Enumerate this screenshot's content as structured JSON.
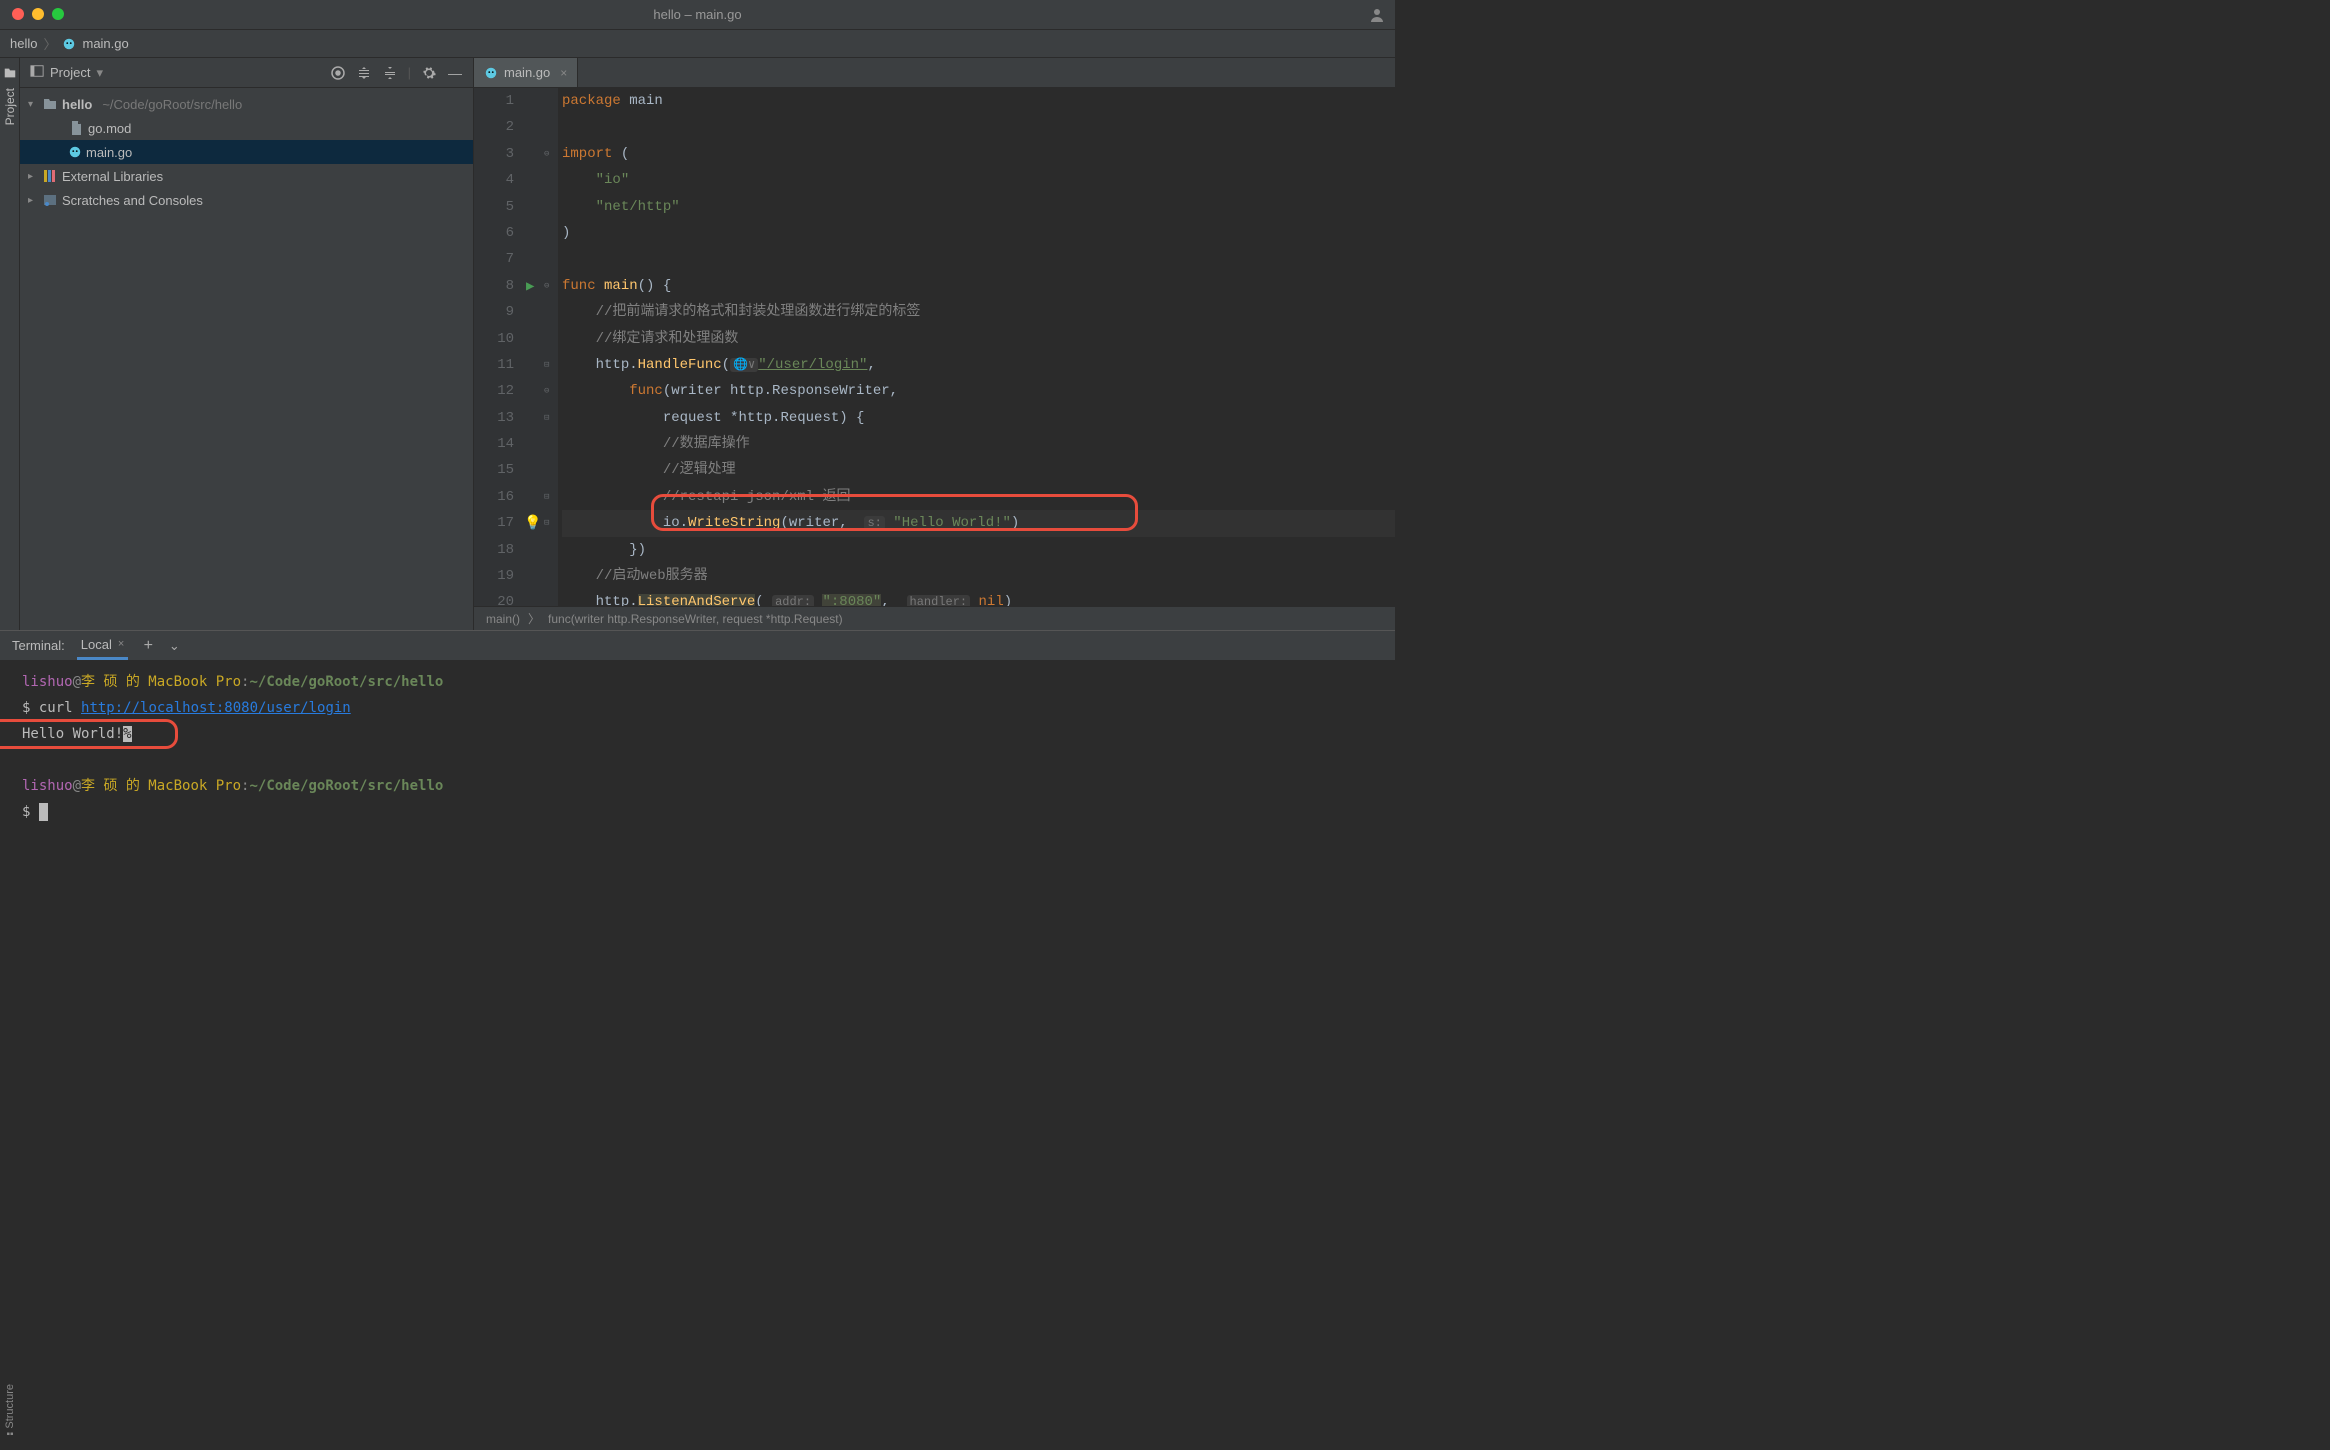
{
  "topbar_center": "hello – main.go",
  "breadcrumb": {
    "root": "hello",
    "file": "main.go"
  },
  "project_panel": {
    "title": "Project",
    "tree": {
      "root": {
        "name": "hello",
        "path": "~/Code/goRoot/src/hello"
      },
      "files": [
        "go.mod",
        "main.go"
      ],
      "ext_libs": "External Libraries",
      "scratches": "Scratches and Consoles"
    }
  },
  "sidebar_tabs": {
    "project": "Project",
    "structure": "Structure"
  },
  "editor": {
    "tab": "main.go",
    "lines": [
      {
        "n": 1,
        "html": "<span class='kw'>package</span> <span class='ident'>main</span>"
      },
      {
        "n": 2,
        "html": ""
      },
      {
        "n": 3,
        "html": "<span class='kw'>import</span> <span class='ident'>(</span>"
      },
      {
        "n": 4,
        "html": "    <span class='str'>\"io\"</span>"
      },
      {
        "n": 5,
        "html": "    <span class='str'>\"net/http\"</span>"
      },
      {
        "n": 6,
        "html": "<span class='ident'>)</span>"
      },
      {
        "n": 7,
        "html": ""
      },
      {
        "n": 8,
        "html": "<span class='kw'>func</span> <span class='fn'>main</span><span class='ident'>() {</span>"
      },
      {
        "n": 9,
        "html": "    <span class='com'>//把前端请求的格式和封装处理函数进行绑定的标签</span>"
      },
      {
        "n": 10,
        "html": "    <span class='com'>//绑定请求和处理函数</span>"
      },
      {
        "n": 11,
        "html": "    <span class='ident'>http.</span><span class='fn'>HandleFunc</span><span class='ident'>(</span><span class='hint'>🌐∨</span><span class='url'>\"/user/login\"</span><span class='ident'>,</span>"
      },
      {
        "n": 12,
        "html": "        <span class='kw'>func</span><span class='ident'>(writer http.ResponseWriter,</span>"
      },
      {
        "n": 13,
        "html": "            <span class='ident'>request *http.Request) {</span>"
      },
      {
        "n": 14,
        "html": "            <span class='com'>//数据库操作</span>"
      },
      {
        "n": 15,
        "html": "            <span class='com'>//逻辑处理</span>"
      },
      {
        "n": 16,
        "html": "            <span class='com'>//restapi json/xml 返回</span>"
      },
      {
        "n": 17,
        "html": "            <span class='ident'>io.</span><span class='fn'>WriteString</span><span class='ident'>(writer,  </span><span class='hint'>s:</span> <span class='str'>\"Hello World!\"</span><span class='ident'>)</span>"
      },
      {
        "n": 18,
        "html": "        <span class='ident'>})</span>"
      },
      {
        "n": 19,
        "html": "    <span class='com'>//启动web服务器</span>"
      },
      {
        "n": 20,
        "html": "    <span class='ident'>http.</span><span class='fn fnhl'>ListenAndServe</span><span class='ident'>( </span><span class='hint'>addr:</span> <span class='url2'>\":8080\"</span><span class='ident'>,  </span><span class='hint'>handler:</span> <span class='kw'>nil</span><span class='ident'>)</span>"
      }
    ],
    "breadcrumb": {
      "fn": "main()",
      "inner": "func(writer http.ResponseWriter, request *http.Request)"
    }
  },
  "terminal": {
    "title": "Terminal:",
    "tab": "Local",
    "lines": [
      {
        "type": "prompt",
        "user": "lishuo",
        "host": "李 硕 的 MacBook Pro",
        "path": "~/Code/goRoot/src/hello"
      },
      {
        "type": "cmd",
        "prompt": "$ ",
        "cmd_pre": "curl ",
        "url": "http://localhost:8080/user/login"
      },
      {
        "type": "out",
        "text": "Hello World!",
        "suffix": "%"
      },
      {
        "type": "blank"
      },
      {
        "type": "prompt",
        "user": "lishuo",
        "host": "李 硕 的 MacBook Pro",
        "path": "~/Code/goRoot/src/hello"
      },
      {
        "type": "cursor",
        "prompt": "$ "
      }
    ]
  }
}
